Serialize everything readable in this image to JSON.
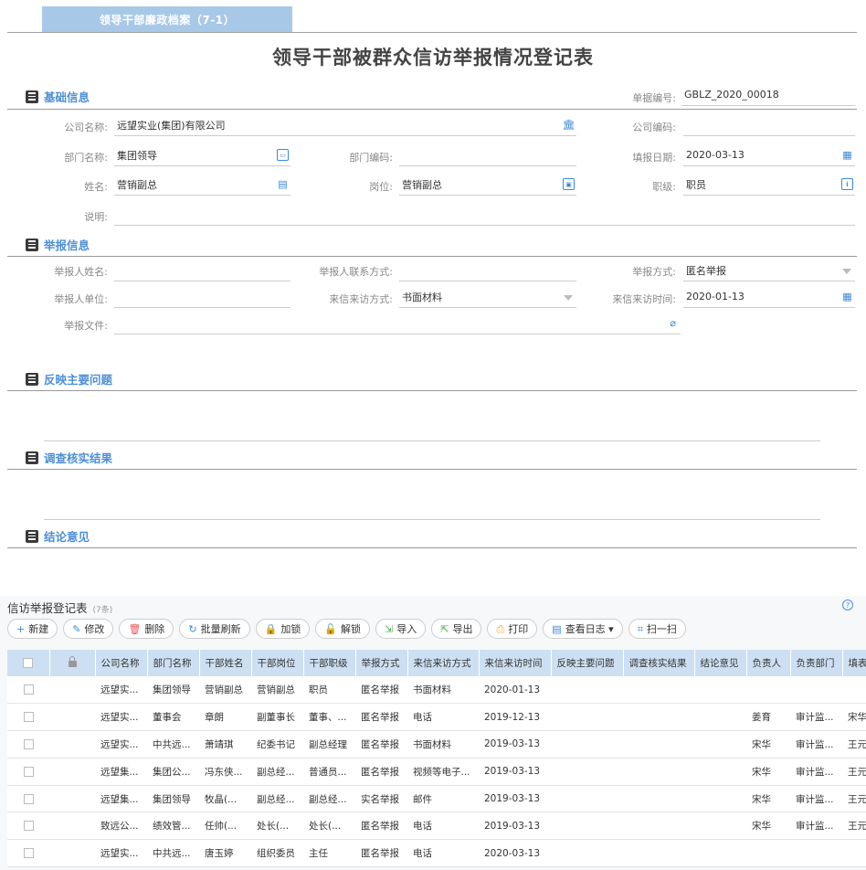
{
  "tab": {
    "label": "领导干部廉政档案（7-1）"
  },
  "title": "领导干部被群众信访举报情况登记表",
  "sections": {
    "basic": "基础信息",
    "report": "举报信息",
    "issues": "反映主要问题",
    "investigation": "调查核实结果",
    "conclusion": "结论意见"
  },
  "doc_no": {
    "label": "单据编号:",
    "value": "GBLZ_2020_00018"
  },
  "basic": {
    "company_name": {
      "label": "公司名称:",
      "value": "远望实业(集团)有限公司",
      "icon": "bank-icon"
    },
    "company_code": {
      "label": "公司编码:",
      "value": ""
    },
    "dept_name": {
      "label": "部门名称:",
      "value": "集团领导",
      "icon": "org-icon"
    },
    "dept_code": {
      "label": "部门编码:",
      "value": ""
    },
    "fill_date": {
      "label": "填报日期:",
      "value": "2020-03-13",
      "icon": "calendar-icon"
    },
    "name": {
      "label": "姓名:",
      "value": "营销副总",
      "icon": "contact-icon"
    },
    "position": {
      "label": "岗位:",
      "value": "营销副总",
      "icon": "id-card-icon"
    },
    "rank": {
      "label": "职级:",
      "value": "职员",
      "icon": "info-icon"
    },
    "note": {
      "label": "说明:",
      "value": ""
    }
  },
  "report": {
    "reporter_name": {
      "label": "举报人姓名:",
      "value": ""
    },
    "reporter_contact": {
      "label": "举报人联系方式:",
      "value": ""
    },
    "report_method": {
      "label": "举报方式:",
      "value": "匿名举报"
    },
    "reporter_unit": {
      "label": "举报人单位:",
      "value": ""
    },
    "visit_method": {
      "label": "来信来访方式:",
      "value": "书面材料"
    },
    "visit_time": {
      "label": "来信来访时间:",
      "value": "2020-01-13"
    },
    "report_file": {
      "label": "举报文件:",
      "value": "",
      "icon": "paperclip-icon"
    }
  },
  "list": {
    "title": "信访举报登记表",
    "count": "(7条)",
    "help": "?",
    "toolbar": [
      {
        "icon": "+",
        "label": "新建",
        "color": "#3b88d8"
      },
      {
        "icon": "✎",
        "label": "修改",
        "color": "#3b88d8"
      },
      {
        "icon": "🗑",
        "label": "删除",
        "color": "#e55"
      },
      {
        "icon": "↻",
        "label": "批量刷新",
        "color": "#3b88d8"
      },
      {
        "icon": "🔒",
        "label": "加锁",
        "color": "#3b88d8"
      },
      {
        "icon": "🔓",
        "label": "解锁",
        "color": "#3b88d8"
      },
      {
        "icon": "⇲",
        "label": "导入",
        "color": "#4caf50"
      },
      {
        "icon": "⇱",
        "label": "导出",
        "color": "#4caf50"
      },
      {
        "icon": "⎙",
        "label": "打印",
        "color": "#f0a030"
      },
      {
        "icon": "▤",
        "label": "查看日志 ▾",
        "color": "#3b88d8"
      },
      {
        "icon": "⌗",
        "label": "扫一扫",
        "color": "#3b88d8"
      }
    ],
    "columns": [
      "公司名称",
      "部门名称",
      "干部姓名",
      "干部岗位",
      "干部职级",
      "举报方式",
      "来信来访方式",
      "来信来访时间",
      "反映主要问题",
      "调查核实结果",
      "结论意见",
      "负责人",
      "负责部门",
      "填表"
    ],
    "rows": [
      [
        "远望实...",
        "集团领导",
        "营销副总",
        "营销副总",
        "职员",
        "匿名举报",
        "书面材料",
        "2020-01-13",
        "",
        "",
        "",
        "",
        "",
        ""
      ],
      [
        "远望实...",
        "董事会",
        "章朗",
        "副董事长",
        "董事、...",
        "匿名举报",
        "电话",
        "2019-12-13",
        "",
        "",
        "",
        "姜育",
        "审计监...",
        "宋华"
      ],
      [
        "远望实...",
        "中共远...",
        "萧靖琪",
        "纪委书记",
        "副总经理",
        "匿名举报",
        "书面材料",
        "2019-03-13",
        "",
        "",
        "",
        "宋华",
        "审计监...",
        "王元"
      ],
      [
        "远望集...",
        "集团公...",
        "冯东侠...",
        "副总经...",
        "普通员...",
        "匿名举报",
        "视频等电子...",
        "2019-03-13",
        "",
        "",
        "",
        "宋华",
        "审计监...",
        "王元"
      ],
      [
        "远望集...",
        "集团领导",
        "牧晶(...",
        "副总经...",
        "副总经...",
        "实名举报",
        "邮件",
        "2019-03-13",
        "",
        "",
        "",
        "宋华",
        "审计监...",
        "王元"
      ],
      [
        "致远公...",
        "绩效管...",
        "任帅(...",
        "处长(...",
        "处长(...",
        "匿名举报",
        "电话",
        "2019-03-13",
        "",
        "",
        "",
        "宋华",
        "审计监...",
        "王元"
      ],
      [
        "远望实...",
        "中共远...",
        "唐玉婷",
        "组织委员",
        "主任",
        "匿名举报",
        "电话",
        "2020-03-13",
        "",
        "",
        "",
        "",
        "",
        ""
      ]
    ]
  }
}
